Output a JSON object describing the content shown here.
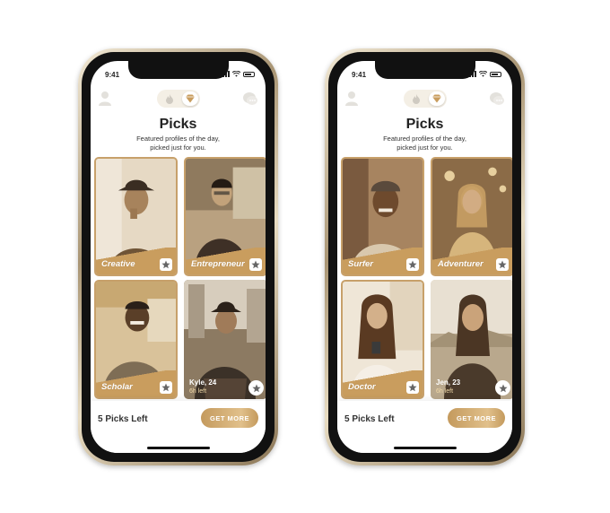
{
  "status": {
    "time": "9:41"
  },
  "screen": {
    "title": "Picks",
    "subtitle_line1": "Featured profiles of the day,",
    "subtitle_line2": "picked just for you."
  },
  "bottom": {
    "picks_left": "5 Picks Left",
    "get_more_label": "GET MORE"
  },
  "phones": [
    {
      "cards": [
        {
          "label": "Creative"
        },
        {
          "label": "Entrepreneur"
        },
        {
          "label": "Scholar"
        },
        {
          "name": "Kyle, 24",
          "time": "6h left"
        }
      ]
    },
    {
      "cards": [
        {
          "label": "Surfer"
        },
        {
          "label": "Adventurer"
        },
        {
          "label": "Doctor"
        },
        {
          "name": "Jen, 23",
          "time": "6h left"
        }
      ]
    }
  ],
  "colors": {
    "gold": "#c99d5e",
    "gold_light": "#e1c08b",
    "text_dark": "#222222"
  },
  "icons": [
    "profile-icon",
    "flame-icon",
    "diamond-icon",
    "chat-icon",
    "star-icon",
    "signal-icon",
    "wifi-icon",
    "battery-icon"
  ]
}
